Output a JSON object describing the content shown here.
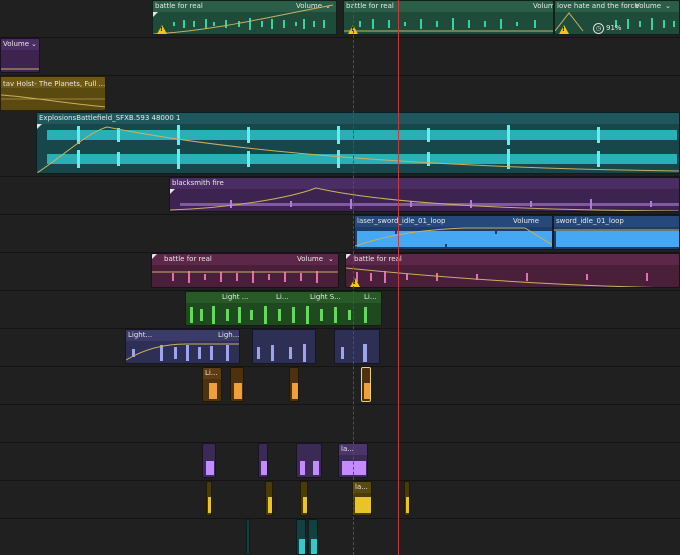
{
  "labels": {
    "battle": "battle for real",
    "volume": "Volume",
    "love": "love hate and the force",
    "holst": "tav Holst- The Planets, Full ...",
    "explosions": "ExplosionsBattlefield_SFXB.593 48000 1",
    "blacksmith": "blacksmith fire",
    "laser": "laser_sword_idle_01_loop",
    "sword": "sword_idle_01_loop",
    "light_a": "Light ...",
    "light_b": "Li...",
    "light_c": "Light S...",
    "light_d": "Ligh...",
    "light_e": "Light...",
    "light_f": "Li...",
    "la": "la..."
  },
  "render_status": "91%",
  "colors": {
    "green": "#1f4b3a",
    "green_wave": "#3bd29a",
    "purple": "#3d2450",
    "purple_wave": "#b07cd8",
    "yellow": "#5b4a10",
    "teal": "#17464b",
    "teal_wave": "#2fd4d9",
    "magenta": "#4a1f3a",
    "magenta_wave": "#e46fb3",
    "blue": "#1d3c66",
    "blue_wave": "#46a7f2",
    "lightgreen": "#1f4a1f",
    "lightgreen_wave": "#66d85b",
    "lavender": "#2e2f55",
    "lavender_wave": "#9ea3ee",
    "orange": "#4d3210",
    "orange_wave": "#f0a03a",
    "violet": "#3a2a55",
    "violet_wave": "#c48bff",
    "gold": "#4a3c0a",
    "gold_wave": "#e8c428",
    "cyan": "#134040",
    "cyan_wave": "#39c8c8",
    "rubber": "#c7b062",
    "playhead": "#c93a3a"
  },
  "icons": {
    "warning": "warning-triangle-icon",
    "render": "render-progress-icon",
    "menu": "chevron-down-icon"
  }
}
